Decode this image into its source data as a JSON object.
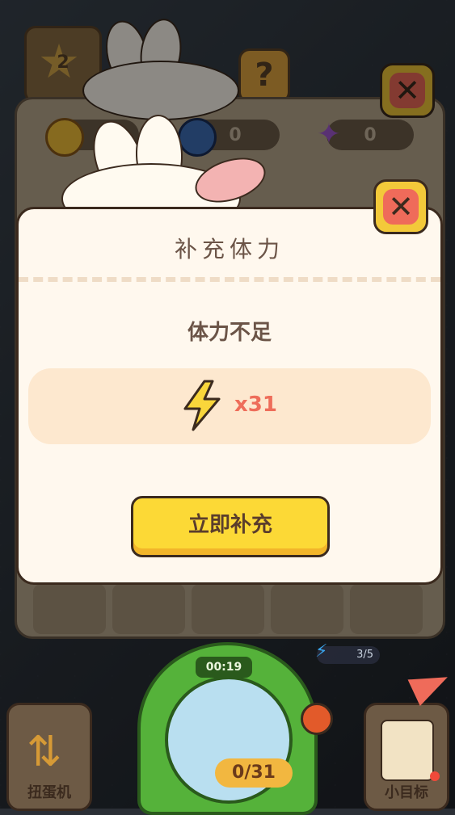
{
  "background": {
    "level": "2"
  },
  "resources": [
    {
      "icon": "sun-icon",
      "value": ""
    },
    {
      "icon": "moon-icon",
      "value": "0"
    },
    {
      "icon": "star-icon",
      "value": "0"
    }
  ],
  "dialog": {
    "title": "补充体力",
    "subtitle": "体力不足",
    "reward": {
      "icon": "lightning-bolt-icon",
      "quantity": "x31"
    },
    "confirm_label": "立即补充",
    "close_icon": "close-icon"
  },
  "bottom": {
    "timer": "00:19",
    "capsule_count": "0/31",
    "energy": "3/5",
    "left_button_label": "扭蛋机",
    "right_button_label": "小目标"
  },
  "colors": {
    "accent_yellow": "#fcd936",
    "close_red": "#ef6b5a",
    "quantity_red": "#ee6d5a",
    "panel_cream": "#fff8ee",
    "reward_peach": "#fde8cf"
  }
}
